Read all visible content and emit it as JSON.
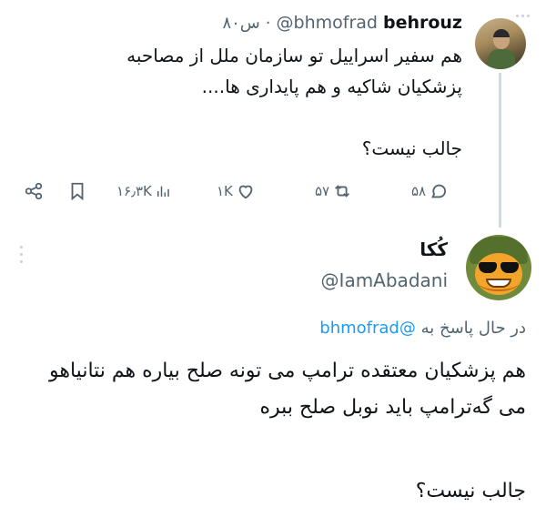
{
  "tweet1": {
    "display_name": "behrouz",
    "handle": "@bhmofrad",
    "time": "۸۰س",
    "separator": "·",
    "text": "هم سفیر اسراییل تو سازمان ملل از مصاحبه پزشکیان شاکیه و هم پایداری ها....",
    "question": "جالب نیست؟",
    "stats": {
      "replies": "۵۸",
      "reposts": "۵۷",
      "likes": "۱K",
      "views": "۱۶٫۳K"
    }
  },
  "tweet2": {
    "display_name": "کُکا",
    "handle": "@IamAbadani",
    "reply_prefix": "در حال پاسخ به",
    "reply_mention": "@bhmofrad",
    "text": "هم پزشکیان معتقده ترامپ می تونه صلح بیاره هم نتانیاهو می گه‌ترامپ باید نوبل صلح ببره",
    "question": "جالب نیست؟"
  },
  "colors": {
    "text": "#0f1419",
    "muted": "#536471",
    "link": "#1d9bf0",
    "thread_line": "#cfd9de"
  },
  "icons": [
    "reply-icon",
    "repost-icon",
    "like-icon",
    "views-icon",
    "bookmark-icon",
    "share-icon"
  ]
}
